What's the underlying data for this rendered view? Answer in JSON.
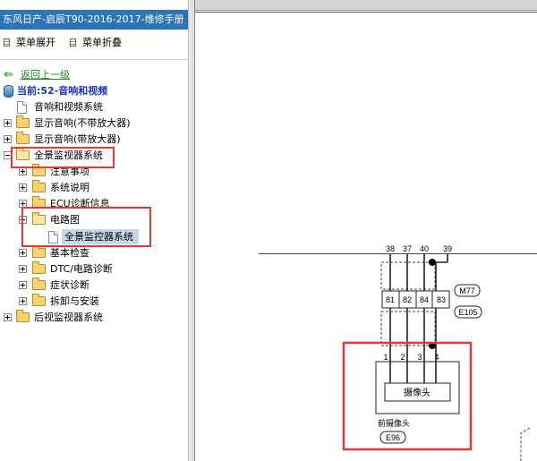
{
  "app": {
    "title": "东风日产-启辰T90-2016-2017-维修手册"
  },
  "toolbar": {
    "expand_label": "菜单展开",
    "collapse_label": "菜单折叠"
  },
  "tree": {
    "back_label": "返回上一级",
    "current_label": "当前:52-音响和视频",
    "items": [
      {
        "label": "音响和视频系统"
      },
      {
        "label": "显示音响(不带放大器)"
      },
      {
        "label": "显示音响(带放大器)"
      },
      {
        "label": "全景监视器系统"
      },
      {
        "label": "注意事项"
      },
      {
        "label": "系统说明"
      },
      {
        "label": "ECU诊断信息"
      },
      {
        "label": "电路图"
      },
      {
        "label": "全景监控器系统"
      },
      {
        "label": "基本检查"
      },
      {
        "label": "DTC/电路诊断"
      },
      {
        "label": "症状诊断"
      },
      {
        "label": "拆卸与安装"
      },
      {
        "label": "后视监视器系统"
      }
    ]
  },
  "diagram": {
    "wire_numbers": [
      "38",
      "37",
      "40",
      "39"
    ],
    "terminal_numbers": [
      "81",
      "82",
      "84",
      "83"
    ],
    "connector_tags": [
      "M77",
      "E105"
    ],
    "pin_numbers": [
      "1",
      "2",
      "3",
      "4"
    ],
    "component_label": "摄像头",
    "component_name": "前摄像头",
    "component_tag": "E96"
  },
  "colors": {
    "title_bar": "#2c74b8",
    "highlight_box": "#e23a3a",
    "link_green": "#1f8a1f",
    "current_blue": "#1a36b8"
  }
}
